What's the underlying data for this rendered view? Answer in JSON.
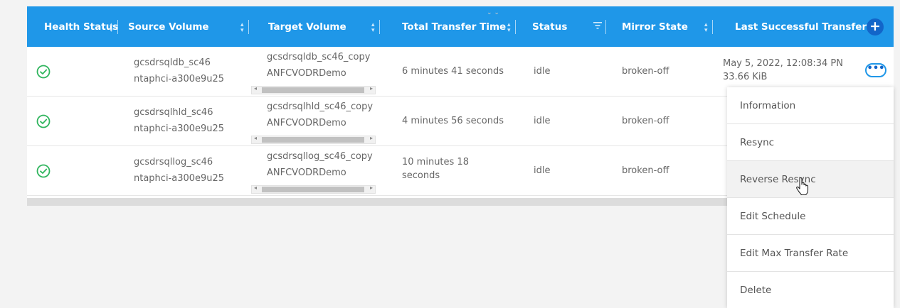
{
  "header": {
    "columns": [
      "Health Status",
      "Source Volume",
      "Target Volume",
      "Total Transfer Time",
      "Status",
      "Mirror State",
      "Last Successful Transfer"
    ],
    "add_icon": "plus-icon"
  },
  "rows": [
    {
      "health_icon": "check-circle-icon",
      "source_line1": "gcsdrsqldb_sc46",
      "source_line2": "ntaphci-a300e9u25",
      "target_line1": "gcsdrsqldb_sc46_copy",
      "target_line2": "ANFCVODRDemo",
      "transfer_time": "6 minutes 41 seconds",
      "status": "idle",
      "mirror_state": "broken-off",
      "last_transfer_line1": "May 5, 2022, 12:08:34 PN",
      "last_transfer_line2": "33.66 KiB"
    },
    {
      "health_icon": "check-circle-icon",
      "source_line1": "gcsdrsqlhld_sc46",
      "source_line2": "ntaphci-a300e9u25",
      "target_line1": "gcsdrsqlhld_sc46_copy",
      "target_line2": "ANFCVODRDemo",
      "transfer_time": "4 minutes 56 seconds",
      "status": "idle",
      "mirror_state": "broken-off"
    },
    {
      "health_icon": "check-circle-icon",
      "source_line1": "gcsdrsqllog_sc46",
      "source_line2": "ntaphci-a300e9u25",
      "target_line1": "gcsdrsqllog_sc46_copy",
      "target_line2": "ANFCVODRDemo",
      "transfer_time_line1": "10 minutes 18",
      "transfer_time_line2": "seconds",
      "status": "idle",
      "mirror_state": "broken-off"
    }
  ],
  "actions_menu": {
    "trigger_icon": "more-horizontal-icon",
    "items": [
      "Information",
      "Resync",
      "Reverse Resync",
      "Edit Schedule",
      "Edit Max Transfer Rate",
      "Delete"
    ],
    "hovered": "Reverse Resync"
  },
  "colors": {
    "header_bg": "#1f97e8",
    "accent": "#1265c9",
    "health_ok": "#2fb55d"
  }
}
